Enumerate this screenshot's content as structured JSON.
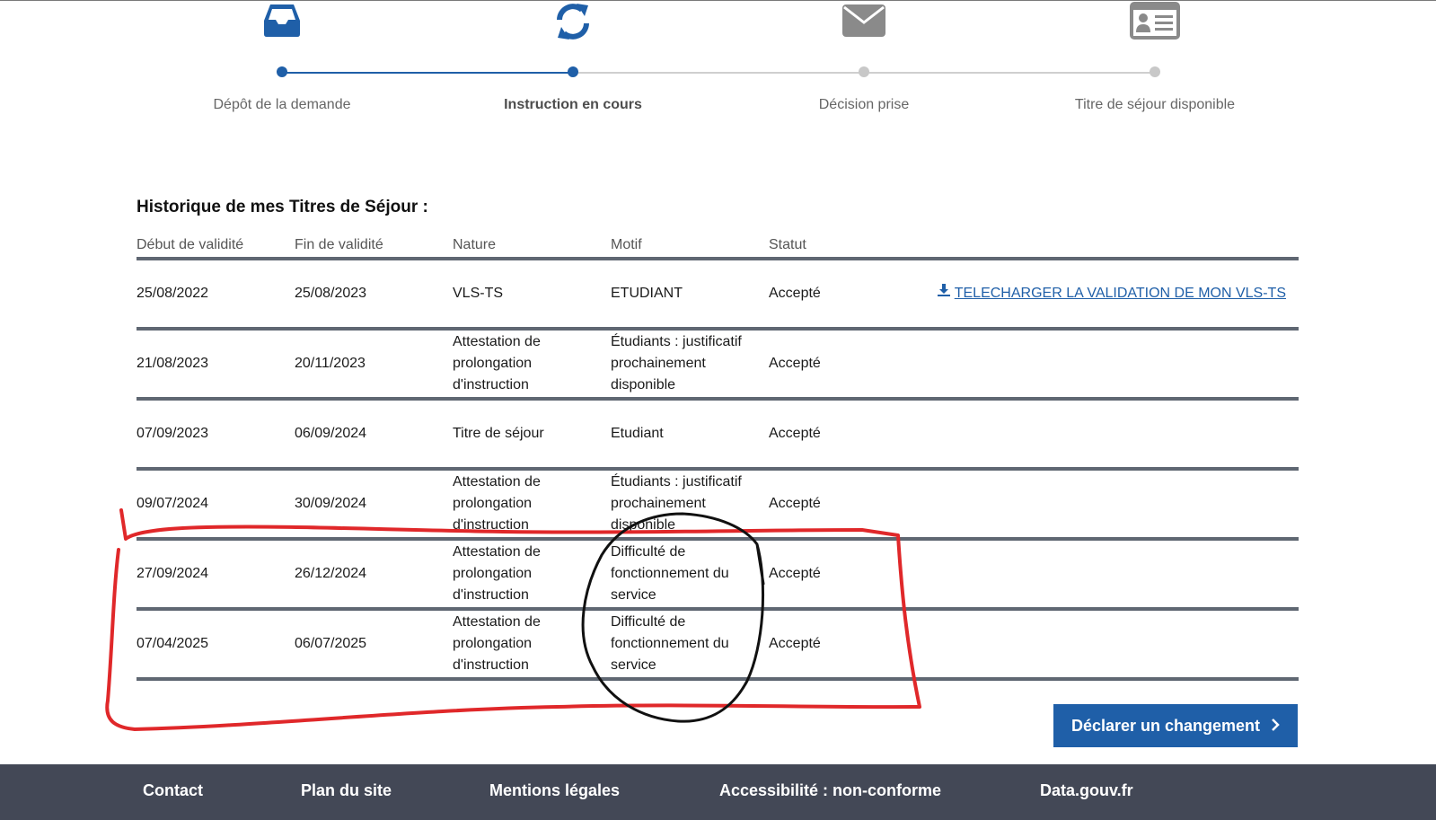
{
  "stepper": {
    "steps": [
      {
        "label": "Dépôt de la demande",
        "icon": "inbox-icon",
        "state": "done"
      },
      {
        "label": "Instruction en cours",
        "icon": "refresh-icon",
        "state": "current"
      },
      {
        "label": "Décision prise",
        "icon": "envelope-icon",
        "state": "pending"
      },
      {
        "label": "Titre de séjour disponible",
        "icon": "id-card-icon",
        "state": "pending"
      }
    ]
  },
  "history": {
    "title": "Historique de mes Titres de Séjour :",
    "columns": [
      "Début de validité",
      "Fin de validité",
      "Nature",
      "Motif",
      "Statut"
    ],
    "rows": [
      {
        "start": "25/08/2022",
        "end": "25/08/2023",
        "nature": "VLS-TS",
        "motif": "ETUDIANT",
        "status": "Accepté",
        "action": "TELECHARGER LA VALIDATION DE MON VLS-TS"
      },
      {
        "start": "21/08/2023",
        "end": "20/11/2023",
        "nature": "Attestation de prolongation d'instruction",
        "motif": "Étudiants : justificatif prochainement disponible",
        "status": "Accepté"
      },
      {
        "start": "07/09/2023",
        "end": "06/09/2024",
        "nature": "Titre de séjour",
        "motif": "Etudiant",
        "status": "Accepté"
      },
      {
        "start": "09/07/2024",
        "end": "30/09/2024",
        "nature": "Attestation de prolongation d'instruction",
        "motif": "Étudiants : justificatif prochainement disponible",
        "status": "Accepté"
      },
      {
        "start": "27/09/2024",
        "end": "26/12/2024",
        "nature": "Attestation de prolongation d'instruction",
        "motif": "Difficulté de fonctionnement du service",
        "status": "Accepté"
      },
      {
        "start": "07/04/2025",
        "end": "06/07/2025",
        "nature": "Attestation de prolongation d'instruction",
        "motif": "Difficulté de fonctionnement du service",
        "status": "Accepté"
      }
    ]
  },
  "actions": {
    "declare_label": "Déclarer un changement"
  },
  "footer": {
    "links": [
      "Contact",
      "Plan du site",
      "Mentions légales",
      "Accessibilité : non-conforme",
      "Data.gouv.fr"
    ]
  },
  "colors": {
    "primary": "#1f5fa8",
    "step_done": "#1f5fa8",
    "step_pending": "#c8c8c8",
    "footer_bg": "#434856",
    "row_divider": "#5f6772",
    "annotation_red": "#e0282a",
    "annotation_black": "#111111"
  }
}
